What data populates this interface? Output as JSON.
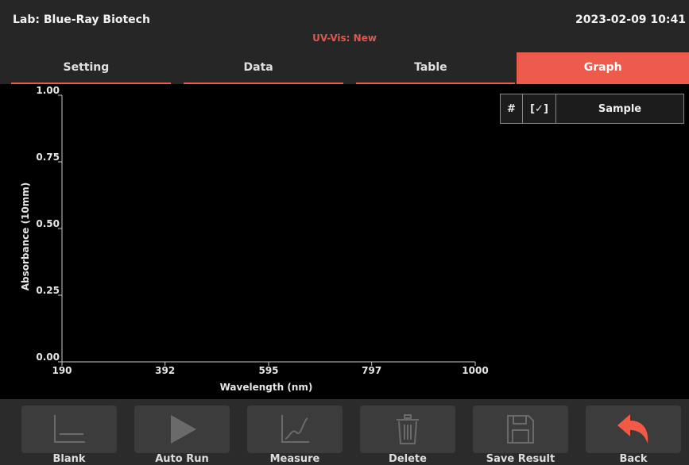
{
  "header": {
    "lab": "Lab: Blue-Ray Biotech",
    "mode": "UV-Vis: New",
    "datetime": "2023-02-09 10:41",
    "mode_color": "#e2574c"
  },
  "tabs": [
    {
      "label": "Setting",
      "active": false
    },
    {
      "label": "Data",
      "active": false
    },
    {
      "label": "Table",
      "active": false
    },
    {
      "label": "Graph",
      "active": true
    }
  ],
  "colors": {
    "accent": "#ee5a4c",
    "axis": "#cccccc",
    "disabled_icon": "#6a6a6a",
    "back_icon": "#f35a45"
  },
  "legend": {
    "number_header": "#",
    "check_header": "[✓]",
    "sample_header": "Sample"
  },
  "chart_data": {
    "type": "line",
    "xlabel": "Wavelength (nm)",
    "ylabel": "Absorbance (10mm)",
    "xlim": [
      190,
      1000
    ],
    "ylim": [
      0.0,
      1.0
    ],
    "x_ticks": [
      "190",
      "392",
      "595",
      "797",
      "1000"
    ],
    "x_tick_values": [
      190,
      392,
      595,
      797,
      1000
    ],
    "y_ticks": [
      "0.00",
      "0.25",
      "0.50",
      "0.75",
      "1.00"
    ],
    "y_tick_values": [
      0.0,
      0.25,
      0.5,
      0.75,
      1.0
    ],
    "series": [],
    "grid": false
  },
  "toolbar": [
    {
      "label": "Blank",
      "icon": "blank-icon",
      "enabled": false
    },
    {
      "label": "Auto Run",
      "icon": "play-icon",
      "enabled": false
    },
    {
      "label": "Measure",
      "icon": "measure-chart-icon",
      "enabled": false
    },
    {
      "label": "Delete",
      "icon": "trash-icon",
      "enabled": false
    },
    {
      "label": "Save Result",
      "icon": "save-icon",
      "enabled": false
    },
    {
      "label": "Back",
      "icon": "back-arrow-icon",
      "enabled": true
    }
  ]
}
